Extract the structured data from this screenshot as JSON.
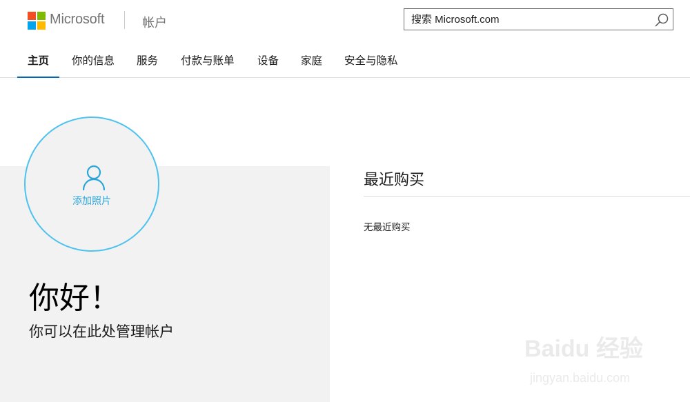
{
  "header": {
    "brand": "Microsoft",
    "section": "帐户",
    "search_placeholder": "搜索 Microsoft.com"
  },
  "nav": {
    "tabs": [
      {
        "label": "主页",
        "active": true
      },
      {
        "label": "你的信息"
      },
      {
        "label": "服务"
      },
      {
        "label": "付款与账单"
      },
      {
        "label": "设备"
      },
      {
        "label": "家庭"
      },
      {
        "label": "安全与隐私"
      }
    ]
  },
  "profile": {
    "add_photo": "添加照片",
    "greeting": "你好！",
    "subtitle": "你可以在此处管理帐户"
  },
  "recent": {
    "title": "最近购买",
    "empty": "无最近购买"
  },
  "watermark": {
    "logo": "Baidu 经验",
    "url": "jingyan.baidu.com"
  },
  "colors": {
    "ms_red": "#f25022",
    "ms_green": "#7fba00",
    "ms_blue": "#00a4ef",
    "ms_yellow": "#ffb900",
    "accent": "#0067b8",
    "avatar_ring": "#4cc2ee"
  }
}
